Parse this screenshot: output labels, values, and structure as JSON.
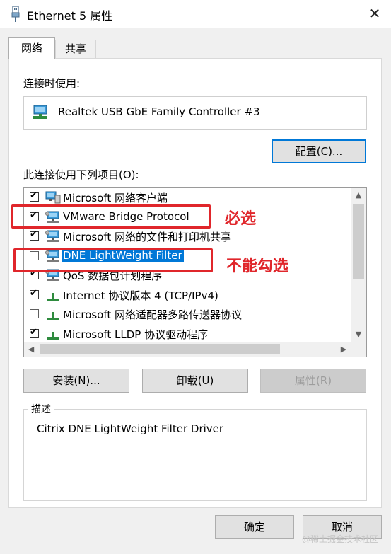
{
  "window": {
    "title": "Ethernet 5 属性",
    "close_glyph": "✕"
  },
  "tabs": [
    "网络",
    "共享"
  ],
  "connect_using_label": "连接时使用:",
  "adapter_name": "Realtek USB GbE Family Controller #3",
  "configure_button": "配置(C)...",
  "items_label": "此连接使用下列项目(O):",
  "items": [
    {
      "label": "Microsoft 网络客户端",
      "checked": true,
      "icon": "network-client-icon"
    },
    {
      "label": "VMware Bridge Protocol",
      "checked": true,
      "icon": "network-service-icon"
    },
    {
      "label": "Microsoft 网络的文件和打印机共享",
      "checked": true,
      "icon": "network-service-icon"
    },
    {
      "label": "DNE LightWeight Filter",
      "checked": false,
      "selected": true,
      "icon": "network-service-icon"
    },
    {
      "label": "QoS 数据包计划程序",
      "checked": true,
      "icon": "network-service-icon"
    },
    {
      "label": "Internet 协议版本 4 (TCP/IPv4)",
      "checked": true,
      "icon": "protocol-icon"
    },
    {
      "label": "Microsoft 网络适配器多路传送器协议",
      "checked": false,
      "icon": "protocol-icon"
    },
    {
      "label": "Microsoft LLDP 协议驱动程序",
      "checked": true,
      "icon": "protocol-icon"
    }
  ],
  "buttons": {
    "install": "安装(N)...",
    "uninstall": "卸载(U)",
    "properties": "属性(R)",
    "ok": "确定",
    "cancel": "取消"
  },
  "description_legend": "描述",
  "description_text": "Citrix DNE LightWeight Filter Driver",
  "annotations": {
    "required": "必选",
    "not_checkable": "不能勾选"
  },
  "watermark": "@稀土掘金技术社区",
  "colors": {
    "selection": "#0078d7",
    "annotation_red": "#e0262b"
  }
}
